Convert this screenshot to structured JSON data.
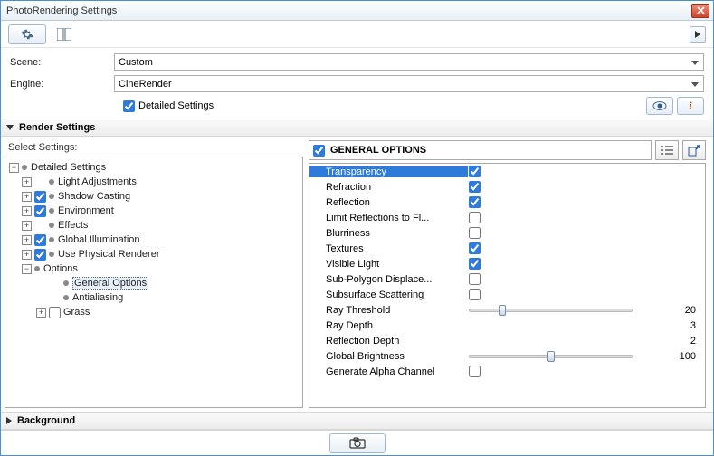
{
  "window": {
    "title": "PhotoRendering Settings"
  },
  "fields": {
    "scene_label": "Scene:",
    "scene_value": "Custom",
    "engine_label": "Engine:",
    "engine_value": "CineRender",
    "detailed_checked": true,
    "detailed_label": "Detailed Settings"
  },
  "sections": {
    "render_settings": "Render Settings",
    "background": "Background",
    "select_settings_label": "Select Settings:"
  },
  "tree": {
    "root": "Detailed Settings",
    "items": [
      {
        "label": "Light Adjustments",
        "chk": null
      },
      {
        "label": "Shadow Casting",
        "chk": true
      },
      {
        "label": "Environment",
        "chk": true
      },
      {
        "label": "Effects",
        "chk": null
      },
      {
        "label": "Global Illumination",
        "chk": true
      },
      {
        "label": "Use Physical Renderer",
        "chk": true
      }
    ],
    "options_label": "Options",
    "options_children": [
      {
        "label": "General Options",
        "selected": true
      },
      {
        "label": "Antialiasing",
        "selected": false
      }
    ],
    "grass": {
      "label": "Grass",
      "chk": false
    }
  },
  "panel": {
    "title": "GENERAL OPTIONS",
    "title_checked": true,
    "rows": [
      {
        "name": "Transparency",
        "type": "check",
        "value": true,
        "selected": true
      },
      {
        "name": "Refraction",
        "type": "check",
        "value": true
      },
      {
        "name": "Reflection",
        "type": "check",
        "value": true
      },
      {
        "name": "Limit Reflections to Fl...",
        "type": "check",
        "value": false
      },
      {
        "name": "Blurriness",
        "type": "check",
        "value": false
      },
      {
        "name": "Textures",
        "type": "check",
        "value": true
      },
      {
        "name": "Visible Light",
        "type": "check",
        "value": true
      },
      {
        "name": "Sub-Polygon Displace...",
        "type": "check",
        "value": false
      },
      {
        "name": "Subsurface Scattering",
        "type": "check",
        "value": false
      },
      {
        "name": "Ray Threshold",
        "type": "slider",
        "value": 20,
        "min": 0,
        "max": 100
      },
      {
        "name": "Ray Depth",
        "type": "number",
        "value": 3
      },
      {
        "name": "Reflection Depth",
        "type": "number",
        "value": 2
      },
      {
        "name": "Global Brightness",
        "type": "slider",
        "value": 100,
        "min": 0,
        "max": 200
      },
      {
        "name": "Generate Alpha Channel",
        "type": "check",
        "value": false
      }
    ]
  }
}
